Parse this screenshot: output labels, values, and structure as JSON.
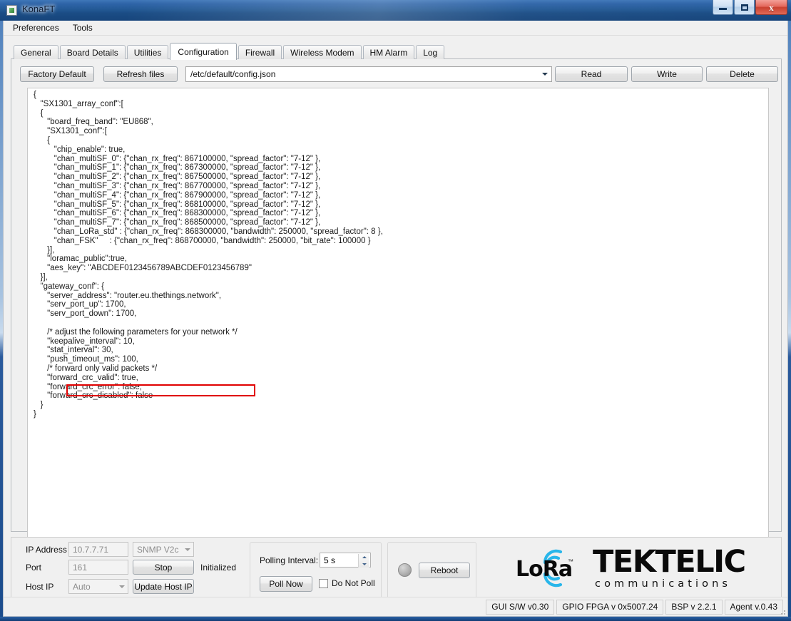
{
  "window": {
    "title": "KonaFT",
    "icon": "app-icon",
    "buttons": {
      "minimize": "minimize",
      "maximize": "maximize",
      "close": "close"
    }
  },
  "menubar": {
    "items": [
      {
        "label": "Preferences"
      },
      {
        "label": "Tools"
      }
    ]
  },
  "tabs": [
    {
      "label": "General",
      "active": false
    },
    {
      "label": "Board Details",
      "active": false
    },
    {
      "label": "Utilities",
      "active": false
    },
    {
      "label": "Configuration",
      "active": true
    },
    {
      "label": "Firewall",
      "active": false
    },
    {
      "label": "Wireless Modem",
      "active": false
    },
    {
      "label": "HM Alarm",
      "active": false
    },
    {
      "label": "Log",
      "active": false
    }
  ],
  "toolbar": {
    "factory_default": "Factory Default",
    "refresh_files": "Refresh files",
    "file_select_value": "/etc/default/config.json",
    "read": "Read",
    "write": "Write",
    "delete": "Delete"
  },
  "editor": {
    "highlighted_line": "\"server_address\": \"router.eu.thethings.network\",",
    "highlight_color": "#e00000",
    "content": "{\n   \"SX1301_array_conf\":[\n   {\n      \"board_freq_band\": \"EU868\",\n      \"SX1301_conf\":[\n      {\n         \"chip_enable\": true,\n         \"chan_multiSF_0\": {\"chan_rx_freq\": 867100000, \"spread_factor\": \"7-12\" },\n         \"chan_multiSF_1\": {\"chan_rx_freq\": 867300000, \"spread_factor\": \"7-12\" },\n         \"chan_multiSF_2\": {\"chan_rx_freq\": 867500000, \"spread_factor\": \"7-12\" },\n         \"chan_multiSF_3\": {\"chan_rx_freq\": 867700000, \"spread_factor\": \"7-12\" },\n         \"chan_multiSF_4\": {\"chan_rx_freq\": 867900000, \"spread_factor\": \"7-12\" },\n         \"chan_multiSF_5\": {\"chan_rx_freq\": 868100000, \"spread_factor\": \"7-12\" },\n         \"chan_multiSF_6\": {\"chan_rx_freq\": 868300000, \"spread_factor\": \"7-12\" },\n         \"chan_multiSF_7\": {\"chan_rx_freq\": 868500000, \"spread_factor\": \"7-12\" },\n         \"chan_LoRa_std\" : {\"chan_rx_freq\": 868300000, \"bandwidth\": 250000, \"spread_factor\": 8 },\n         \"chan_FSK\"     : {\"chan_rx_freq\": 868700000, \"bandwidth\": 250000, \"bit_rate\": 100000 }\n      }],\n      \"loramac_public\":true,\n      \"aes_key\": \"ABCDEF0123456789ABCDEF0123456789\"\n   }],\n   \"gateway_conf\": {\n      \"server_address\": \"router.eu.thethings.network\",\n      \"serv_port_up\": 1700,\n      \"serv_port_down\": 1700,\n\n      /* adjust the following parameters for your network */\n      \"keepalive_interval\": 10,\n      \"stat_interval\": 30,\n      \"push_timeout_ms\": 100,\n      /* forward only valid packets */\n      \"forward_crc_valid\": true,\n      \"forward_crc_error\": false,\n      \"forward_crc_disabled\": false\n   }\n}"
  },
  "connection": {
    "ip_address_label": "IP Address",
    "ip_address_value": "10.7.7.71",
    "snmp_version": "SNMP V2c",
    "port_label": "Port",
    "port_value": "161",
    "stop_button": "Stop",
    "status_text": "Initialized",
    "host_ip_label": "Host IP",
    "host_ip_value": "Auto",
    "update_host_ip_button": "Update Host IP"
  },
  "polling": {
    "interval_label": "Polling Interval:",
    "interval_value": "5 s",
    "poll_now_button": "Poll Now",
    "do_not_poll_label": "Do Not Poll",
    "do_not_poll_checked": false
  },
  "device": {
    "reboot_button": "Reboot",
    "led_state": "off"
  },
  "logos": {
    "lora_text": "LoRa",
    "lora_tm": "™",
    "lora_arc_color": "#29b6ea",
    "tektelic_name": "TEKTELIC",
    "tektelic_sub": "communications"
  },
  "statusbar": {
    "cells": [
      {
        "label": "GUI S/W v0.30"
      },
      {
        "label": "GPIO FPGA v 0x5007.24"
      },
      {
        "label": "BSP v 2.2.1"
      },
      {
        "label": "Agent v.0.43"
      }
    ]
  }
}
